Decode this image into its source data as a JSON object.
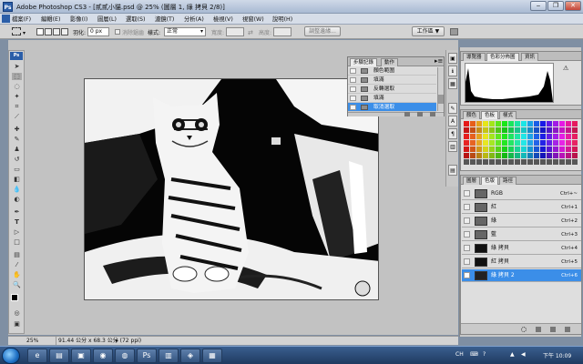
{
  "window": {
    "title": "Adobe Photoshop CS3 - [貳貳小貓.psd @ 25% (圖層 1, 綠 拷貝 2/8)]",
    "app_badge": "Ps"
  },
  "menu": [
    "檔案(F)",
    "編輯(E)",
    "影像(I)",
    "圖層(L)",
    "選取(S)",
    "濾鏡(T)",
    "分析(A)",
    "檢視(V)",
    "視窗(W)",
    "說明(H)"
  ],
  "options": {
    "feather_label": "羽化:",
    "feather_value": "0 px",
    "antialias_label": "消除鋸齒",
    "style_label": "樣式:",
    "style_value": "正常",
    "width_label": "寬度:",
    "height_label": "高度:",
    "refine_button": "調整邊緣...",
    "workspace_button": "工作區 ▼"
  },
  "history_panel": {
    "tabs": [
      "步驟記錄",
      "動作"
    ],
    "steps": [
      "顏色範圍",
      "填滿",
      "反轉選取",
      "填滿",
      "取消選取"
    ],
    "selected_index": 4
  },
  "histogram_panel": {
    "tabs": [
      "導覽器",
      "色彩分佈圖",
      "資訊"
    ]
  },
  "swatches_panel": {
    "tabs": [
      "顏色",
      "色板",
      "樣式"
    ]
  },
  "channels_panel": {
    "tabs": [
      "圖層",
      "色版",
      "路徑"
    ],
    "rows": [
      {
        "name": "RGB",
        "shortcut": "Ctrl+~"
      },
      {
        "name": "紅",
        "shortcut": "Ctrl+1"
      },
      {
        "name": "綠",
        "shortcut": "Ctrl+2"
      },
      {
        "name": "藍",
        "shortcut": "Ctrl+3"
      },
      {
        "name": "綠 拷貝",
        "shortcut": "Ctrl+4"
      },
      {
        "name": "紅 拷貝",
        "shortcut": "Ctrl+5"
      },
      {
        "name": "綠 拷貝 2",
        "shortcut": "Ctrl+6"
      }
    ],
    "selected_index": 6
  },
  "status": {
    "zoom": "25%",
    "doc_info": "91.44 公分 x 68.3 公分 (72 ppi)"
  },
  "taskbar": {
    "ime": "CH",
    "time": "下午 10:09"
  },
  "colors": {
    "selection": "#3b8ee8",
    "workspace": "#c2c2c2",
    "taskbar": "#2a4a75"
  }
}
